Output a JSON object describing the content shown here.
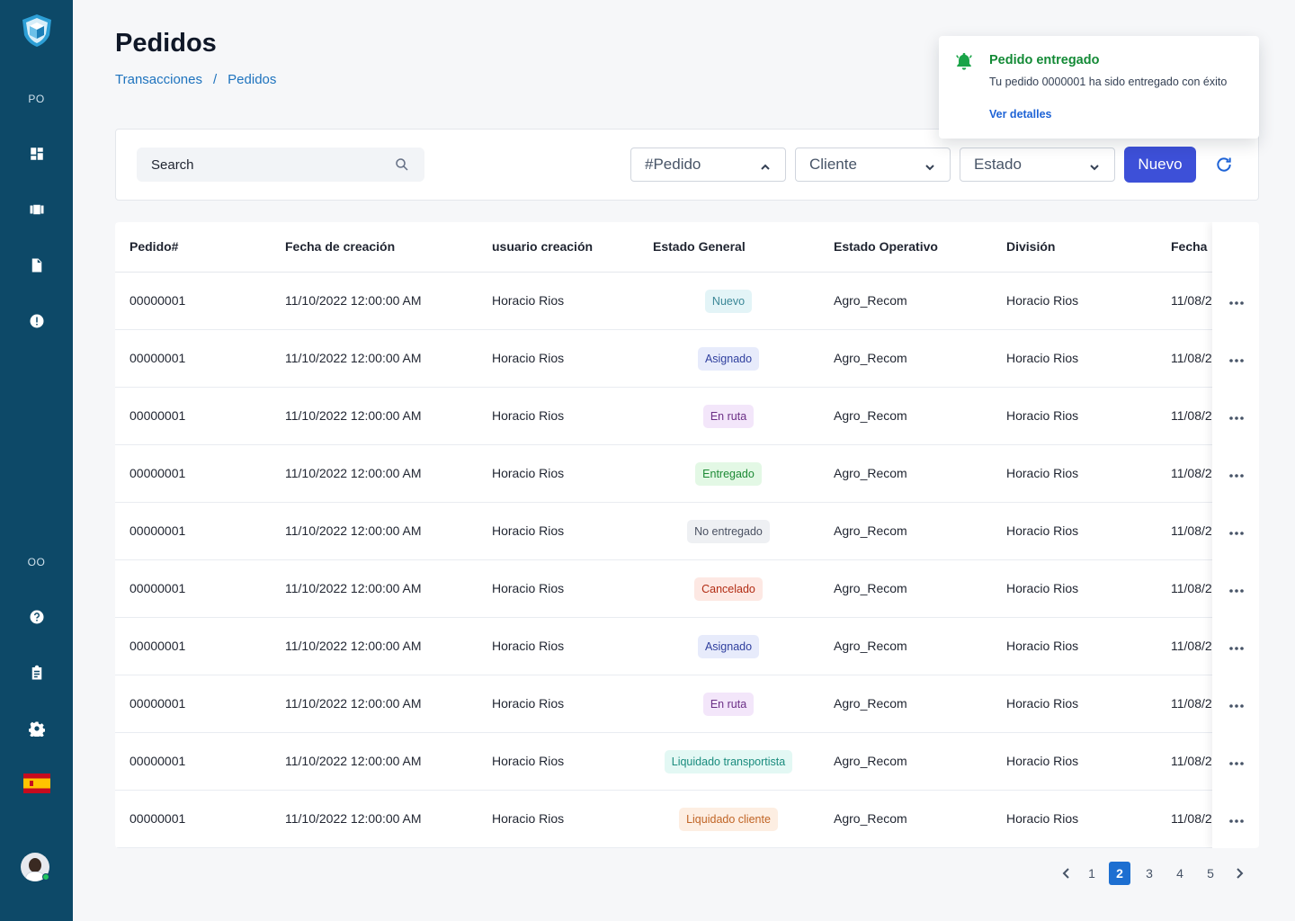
{
  "sidebar": {
    "logo": "shield-cube-icon",
    "top_label": "PO",
    "bottom_label": "OO",
    "nav_icons": [
      "dashboard-icon",
      "trucks-icon",
      "document-icon",
      "alert-icon"
    ],
    "bottom_icons": [
      "help-icon",
      "clipboard-icon",
      "gear-icon"
    ],
    "language": "spain-flag-icon"
  },
  "header": {
    "title": "Pedidos",
    "breadcrumb": [
      "Transacciones",
      "/",
      "Pedidos"
    ]
  },
  "toolbar": {
    "search_label": "Search",
    "filters": [
      "#Pedido",
      "Cliente",
      "Estado"
    ],
    "new_label": "Nuevo"
  },
  "table": {
    "columns": [
      "Pedido#",
      "Fecha de creación",
      "usuario creación",
      "Estado General",
      "Estado Operativo",
      "División",
      "Fecha"
    ],
    "rows": [
      {
        "pedido": "00000001",
        "fecha": "11/10/2022 12:00:00 AM",
        "usuario": "Horacio Rios",
        "estado": "Nuevo",
        "operativo": "Agro_Recom",
        "division": "Horacio Rios",
        "fecha2": "11/08/2"
      },
      {
        "pedido": "00000001",
        "fecha": "11/10/2022 12:00:00 AM",
        "usuario": "Horacio Rios",
        "estado": "Asignado",
        "operativo": "Agro_Recom",
        "division": "Horacio Rios",
        "fecha2": "11/08/2"
      },
      {
        "pedido": "00000001",
        "fecha": "11/10/2022 12:00:00 AM",
        "usuario": "Horacio Rios",
        "estado": "En ruta",
        "operativo": "Agro_Recom",
        "division": "Horacio Rios",
        "fecha2": "11/08/2"
      },
      {
        "pedido": "00000001",
        "fecha": "11/10/2022 12:00:00 AM",
        "usuario": "Horacio Rios",
        "estado": "Entregado",
        "operativo": "Agro_Recom",
        "division": "Horacio Rios",
        "fecha2": "11/08/2"
      },
      {
        "pedido": "00000001",
        "fecha": "11/10/2022 12:00:00 AM",
        "usuario": "Horacio Rios",
        "estado": "No entregado",
        "operativo": "Agro_Recom",
        "division": "Horacio Rios",
        "fecha2": "11/08/2"
      },
      {
        "pedido": "00000001",
        "fecha": "11/10/2022 12:00:00 AM",
        "usuario": "Horacio Rios",
        "estado": "Cancelado",
        "operativo": "Agro_Recom",
        "division": "Horacio Rios",
        "fecha2": "11/08/2"
      },
      {
        "pedido": "00000001",
        "fecha": "11/10/2022 12:00:00 AM",
        "usuario": "Horacio Rios",
        "estado": "Asignado",
        "operativo": "Agro_Recom",
        "division": "Horacio Rios",
        "fecha2": "11/08/2"
      },
      {
        "pedido": "00000001",
        "fecha": "11/10/2022 12:00:00 AM",
        "usuario": "Horacio Rios",
        "estado": "En ruta",
        "operativo": "Agro_Recom",
        "division": "Horacio Rios",
        "fecha2": "11/08/2"
      },
      {
        "pedido": "00000001",
        "fecha": "11/10/2022 12:00:00 AM",
        "usuario": "Horacio Rios",
        "estado": "Liquidado transportista",
        "operativo": "Agro_Recom",
        "division": "Horacio Rios",
        "fecha2": "11/08/2"
      },
      {
        "pedido": "00000001",
        "fecha": "11/10/2022 12:00:00 AM",
        "usuario": "Horacio Rios",
        "estado": "Liquidado cliente",
        "operativo": "Agro_Recom",
        "division": "Horacio Rios",
        "fecha2": "11/08/2"
      }
    ],
    "row_action_icon": "more-horizontal-icon"
  },
  "status_colors": {
    "Nuevo": {
      "bg": "#e3f4f7",
      "fg": "#3b8797"
    },
    "Asignado": {
      "bg": "#e7ebfb",
      "fg": "#2f3f9e"
    },
    "En ruta": {
      "bg": "#f3e6fa",
      "fg": "#6b2f86"
    },
    "Entregado": {
      "bg": "#e3f8e5",
      "fg": "#1d8a35"
    },
    "No entregado": {
      "bg": "#eef0f3",
      "fg": "#4a5162"
    },
    "Cancelado": {
      "bg": "#fde8e3",
      "fg": "#b22d14"
    },
    "Liquidado transportista": {
      "bg": "#e3f8f4",
      "fg": "#1a8c7e"
    },
    "Liquidado cliente": {
      "bg": "#fdeee2",
      "fg": "#c06425"
    }
  },
  "pagination": {
    "pages": [
      "1",
      "2",
      "3",
      "4",
      "5"
    ],
    "current": "2"
  },
  "toast": {
    "title": "Pedido entregado",
    "message": "Tu pedido 0000001 ha sido entregado con éxito",
    "link": "Ver detalles"
  }
}
